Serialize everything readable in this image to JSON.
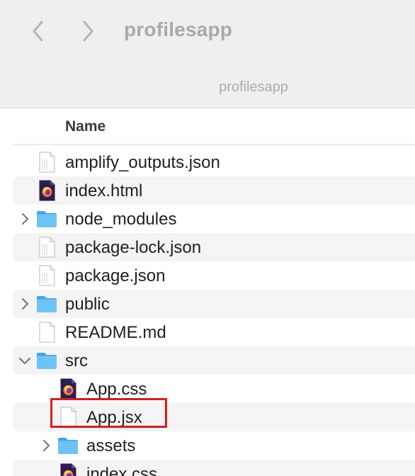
{
  "toolbar": {
    "title": "profilesapp",
    "path": "profilesapp"
  },
  "columns": {
    "name": "Name"
  },
  "highlight_color": "#e0191f",
  "rows": [
    {
      "label": "amplify_outputs.json",
      "icon": "generic-doc-icon",
      "level": 0,
      "disclosure": "none"
    },
    {
      "label": "index.html",
      "icon": "firefox-doc-icon",
      "level": 0,
      "disclosure": "none"
    },
    {
      "label": "node_modules",
      "icon": "folder-icon",
      "level": 0,
      "disclosure": "collapsed"
    },
    {
      "label": "package-lock.json",
      "icon": "generic-doc-icon",
      "level": 0,
      "disclosure": "none"
    },
    {
      "label": "package.json",
      "icon": "generic-doc-icon",
      "level": 0,
      "disclosure": "none"
    },
    {
      "label": "public",
      "icon": "folder-icon",
      "level": 0,
      "disclosure": "collapsed"
    },
    {
      "label": "README.md",
      "icon": "blank-doc-icon",
      "level": 0,
      "disclosure": "none"
    },
    {
      "label": "src",
      "icon": "folder-icon",
      "level": 0,
      "disclosure": "expanded"
    },
    {
      "label": "App.css",
      "icon": "firefox-doc-icon",
      "level": 1,
      "disclosure": "none"
    },
    {
      "label": "App.jsx",
      "icon": "blank-doc-icon",
      "level": 1,
      "disclosure": "none",
      "highlighted": true
    },
    {
      "label": "assets",
      "icon": "folder-icon",
      "level": 1,
      "disclosure": "collapsed"
    },
    {
      "label": "index.css",
      "icon": "firefox-doc-icon",
      "level": 1,
      "disclosure": "none"
    }
  ]
}
